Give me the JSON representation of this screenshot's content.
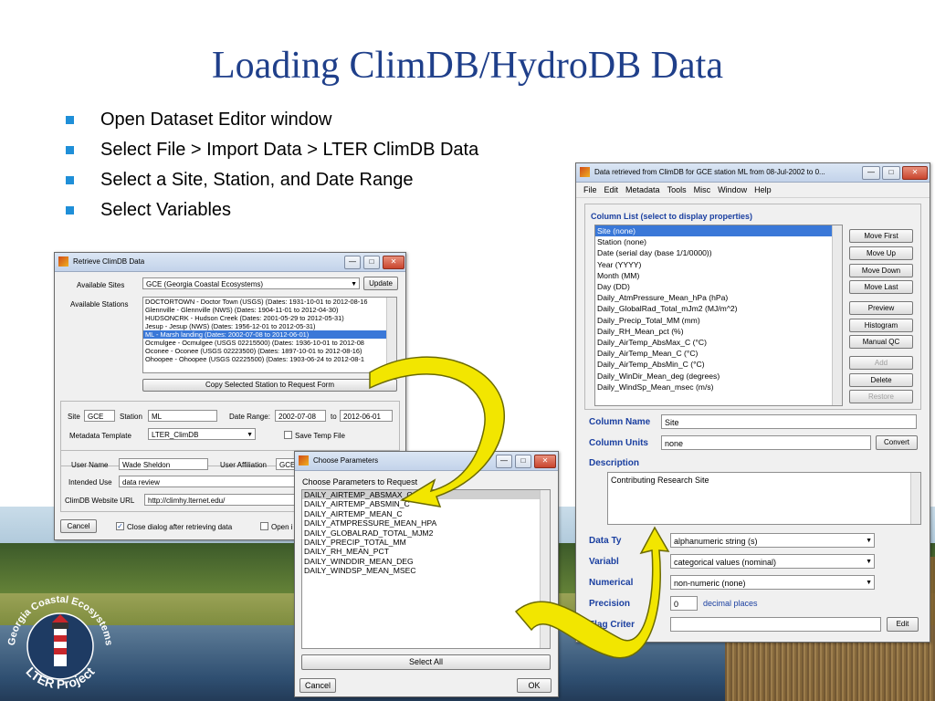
{
  "slide": {
    "title": "Loading ClimDB/HydroDB Data",
    "bullets": [
      "Open Dataset Editor window",
      "Select File > Import Data > LTER ClimDB Data",
      "Select a Site, Station, and Date Range",
      "Select Variables"
    ]
  },
  "logo": {
    "top_text": "Georgia Coastal Ecosystems",
    "bottom_text": "LTER Project"
  },
  "retrieve": {
    "title": "Retrieve ClimDB Data",
    "available_sites_label": "Available Sites",
    "site_value": "GCE (Georgia Coastal Ecosystems)",
    "update_button": "Update",
    "available_stations_label": "Available Stations",
    "stations": [
      "DOCTORTOWN - Doctor Town (USGS)  (Dates: 1931-10-01 to 2012-08-16",
      "Glennville - Glennville (NWS)  (Dates: 1904-11-01 to 2012-04-30)",
      "HUDSONCRK - Hudson Creek  (Dates: 2001-05-29 to 2012-05-31)",
      "Jesup - Jesup  (NWS)  (Dates: 1956-12-01 to 2012-05-31)",
      "ML - Marsh landing  (Dates: 2002-07-08 to 2012-06-01)",
      "Ocmulgee - Ocmulgee (USGS 02215500)  (Dates: 1936-10-01 to 2012-08",
      "Oconee - Oconee  (USGS 02223500)  (Dates: 1897-10-01 to 2012-08-16)",
      "Ohoopee - Ohoopee (USGS 02225500)  (Dates: 1903-06-24 to 2012-08-1"
    ],
    "copy_button": "Copy Selected Station to Request Form",
    "site_label": "Site",
    "site_code": "GCE",
    "station_label": "Station",
    "station_code": "ML",
    "date_range_label": "Date Range:",
    "date_from": "2002-07-08",
    "to_label": "to",
    "date_to": "2012-06-01",
    "metadata_template_label": "Metadata Template",
    "metadata_template_value": "LTER_ClimDB",
    "save_temp_file_label": "Save Temp File",
    "user_name_label": "User Name",
    "user_name_value": "Wade Sheldon",
    "user_affiliation_label": "User Affiliation",
    "user_affiliation_value": "GCE",
    "intended_use_label": "Intended Use",
    "intended_use_value": "data review",
    "website_label": "ClimDB Website URL",
    "website_value": "http://climhy.lternet.edu/",
    "cancel_button": "Cancel",
    "close_dialog_label": "Close dialog after retrieving data",
    "open_label": "Open i"
  },
  "params": {
    "title": "Choose Parameters",
    "header": "Choose Parameters to Request",
    "items": [
      "DAILY_AIRTEMP_ABSMAX_C",
      "DAILY_AIRTEMP_ABSMIN_C",
      "DAILY_AIRTEMP_MEAN_C",
      "DAILY_ATMPRESSURE_MEAN_HPA",
      "DAILY_GLOBALRAD_TOTAL_MJM2",
      "DAILY_PRECIP_TOTAL_MM",
      "DAILY_RH_MEAN_PCT",
      "DAILY_WINDDIR_MEAN_DEG",
      "DAILY_WINDSP_MEAN_MSEC"
    ],
    "select_all": "Select All",
    "cancel": "Cancel",
    "ok": "OK"
  },
  "editor": {
    "title": "Data retrieved from ClimDB for GCE station ML from 08-Jul-2002 to 0...",
    "menu": [
      "File",
      "Edit",
      "Metadata",
      "Tools",
      "Misc",
      "Window",
      "Help"
    ],
    "column_list_label": "Column List (select to display properties)",
    "columns": [
      "Site  (none)",
      "Station  (none)",
      "Date  (serial day (base 1/1/0000))",
      "Year  (YYYY)",
      "Month  (MM)",
      "Day  (DD)",
      "Daily_AtmPressure_Mean_hPa  (hPa)",
      "Daily_GlobalRad_Total_mJm2  (MJ/m^2)",
      "Daily_Precip_Total_MM  (mm)",
      "Daily_RH_Mean_pct  (%)",
      "Daily_AirTemp_AbsMax_C  (°C)",
      "Daily_AirTemp_Mean_C  (°C)",
      "Daily_AirTemp_AbsMin_C  (°C)",
      "Daily_WinDir_Mean_deg  (degrees)",
      "Daily_WindSp_Mean_msec  (m/s)"
    ],
    "buttons": [
      "Move First",
      "Move Up",
      "Move Down",
      "Move Last",
      "Preview",
      "Histogram",
      "Manual QC",
      "Add",
      "Delete",
      "Restore"
    ],
    "column_name_label": "Column Name",
    "column_name_value": "Site",
    "column_units_label": "Column Units",
    "column_units_value": "none",
    "convert_button": "Convert",
    "description_label": "Description",
    "description_value": "Contributing Research Site",
    "data_type_label": "Data Ty",
    "data_type_value": "alphanumeric string (s)",
    "variable_label": "Variabl",
    "variable_value": "categorical values (nominal)",
    "numerical_label": "Numerical",
    "numerical_value": "non-numeric (none)",
    "precision_label": "Precision",
    "precision_value": "0",
    "decimal_places": "decimal places",
    "flag_label": "Flag Criter",
    "edit_button": "Edit"
  }
}
